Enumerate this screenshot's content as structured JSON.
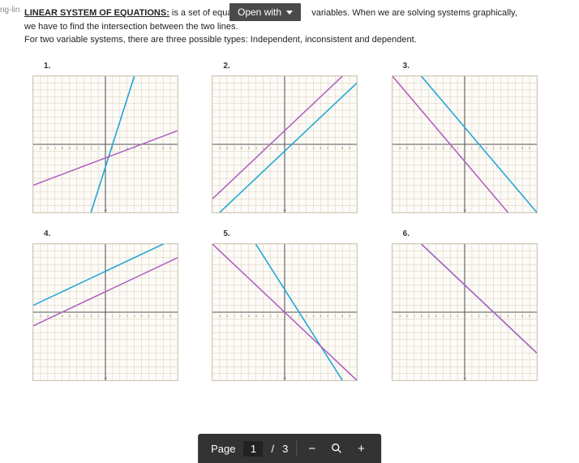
{
  "top": {
    "ing_link": "ng-lin",
    "heading": "LINEAR SYSTEM OF EQUATIONS:",
    "line1_a": " is a set of equatio",
    "line1_b": " variables. When we are solving systems graphically,",
    "line2": "we have to find the intersection between the two lines.",
    "line3": "For two variable systems, there are three possible types: Independent, inconsistent and dependent."
  },
  "open_with": {
    "label": "Open with"
  },
  "graphs": [
    {
      "label": "1."
    },
    {
      "label": "2."
    },
    {
      "label": "3."
    },
    {
      "label": "4."
    },
    {
      "label": "5."
    },
    {
      "label": "6."
    }
  ],
  "chart_data": [
    {
      "id": 1,
      "type": "line",
      "xrange": [
        -10,
        10
      ],
      "yrange": [
        -10,
        10
      ],
      "series": [
        {
          "name": "line-a",
          "color": "#1fa6d6",
          "points": [
            [
              -2,
              -10
            ],
            [
              4,
              10
            ]
          ]
        },
        {
          "name": "line-b",
          "color": "#b060c0",
          "points": [
            [
              -10,
              -6
            ],
            [
              10,
              2
            ]
          ]
        }
      ]
    },
    {
      "id": 2,
      "type": "line",
      "xrange": [
        -10,
        10
      ],
      "yrange": [
        -10,
        10
      ],
      "series": [
        {
          "name": "line-a",
          "color": "#1fa6d6",
          "points": [
            [
              -9,
              -10
            ],
            [
              10,
              9
            ]
          ]
        },
        {
          "name": "line-b",
          "color": "#b060c0",
          "points": [
            [
              -10,
              -8
            ],
            [
              10,
              12
            ]
          ]
        }
      ]
    },
    {
      "id": 3,
      "type": "line",
      "xrange": [
        -10,
        10
      ],
      "yrange": [
        -10,
        10
      ],
      "series": [
        {
          "name": "line-a",
          "color": "#1fa6d6",
          "points": [
            [
              -6,
              10
            ],
            [
              10,
              -10
            ]
          ]
        },
        {
          "name": "line-b",
          "color": "#b060c0",
          "points": [
            [
              -10,
              10
            ],
            [
              6,
              -10
            ]
          ]
        }
      ]
    },
    {
      "id": 4,
      "type": "line",
      "xrange": [
        -10,
        10
      ],
      "yrange": [
        -10,
        10
      ],
      "series": [
        {
          "name": "line-a",
          "color": "#1fa6d6",
          "points": [
            [
              -10,
              1
            ],
            [
              10,
              11
            ]
          ]
        },
        {
          "name": "line-b",
          "color": "#b060c0",
          "points": [
            [
              -10,
              -2
            ],
            [
              10,
              8
            ]
          ]
        }
      ]
    },
    {
      "id": 5,
      "type": "line",
      "xrange": [
        -10,
        10
      ],
      "yrange": [
        -10,
        10
      ],
      "series": [
        {
          "name": "line-a",
          "color": "#1fa6d6",
          "points": [
            [
              -4,
              10
            ],
            [
              8,
              -10
            ]
          ]
        },
        {
          "name": "line-b",
          "color": "#b060c0",
          "points": [
            [
              -10,
              10
            ],
            [
              10,
              -10
            ]
          ]
        }
      ]
    },
    {
      "id": 6,
      "type": "line",
      "xrange": [
        -10,
        10
      ],
      "yrange": [
        -10,
        10
      ],
      "series": [
        {
          "name": "line-a",
          "color": "#1fa6d6",
          "points": [
            [
              -6,
              10
            ],
            [
              10,
              -6
            ]
          ]
        },
        {
          "name": "line-b",
          "color": "#b060c0",
          "points": [
            [
              -6,
              10
            ],
            [
              10,
              -6
            ]
          ]
        }
      ]
    }
  ],
  "toolbar": {
    "page_label": "Page",
    "current": "1",
    "slash": "/",
    "total": "3",
    "minus": "−",
    "plus": "+"
  }
}
